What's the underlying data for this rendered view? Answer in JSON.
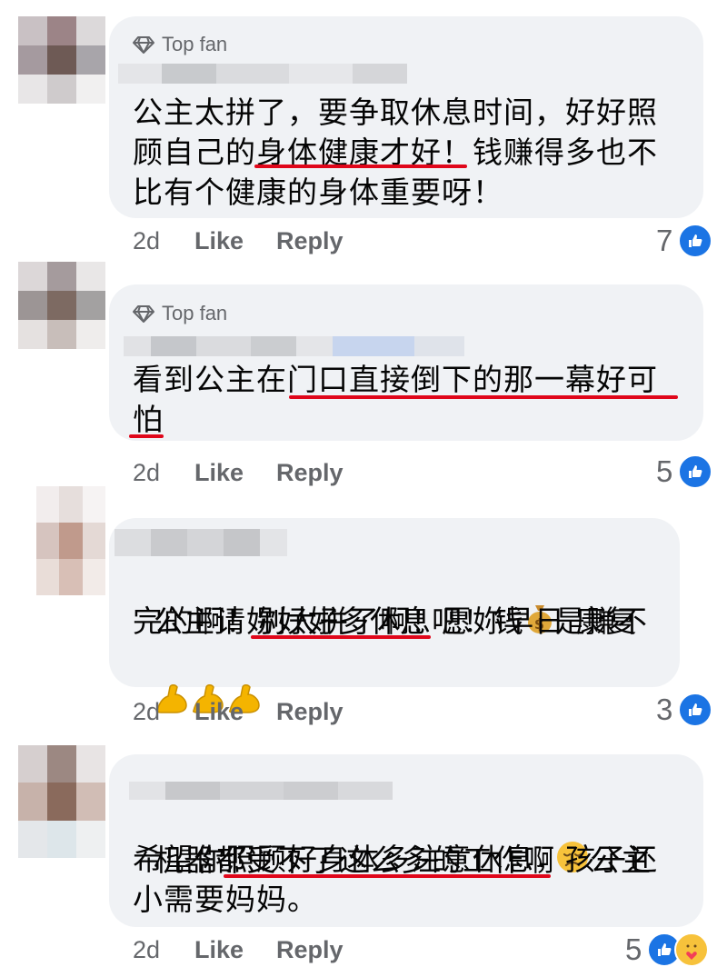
{
  "labels": {
    "top_fan": "Top fan",
    "like": "Like",
    "reply": "Reply"
  },
  "colors": {
    "bubble": "#f0f2f5",
    "underline": "#e0061a",
    "like_blue": "#1b74e4",
    "meta_gray": "#65676b"
  },
  "comments": [
    {
      "top_fan": true,
      "lines": [
        "公主太拼了，要争取休息时间，好好照",
        "顾自己的身体健康才好！钱赚得多也不",
        "比有个健康的身体重要呀！"
      ],
      "age": "2d",
      "reactions": {
        "count": "7",
        "icons": [
          "like-icon"
        ]
      }
    },
    {
      "top_fan": true,
      "lines": [
        "看到公主在门口直接倒下的那一幕好可",
        "怕"
      ],
      "age": "2d",
      "reactions": {
        "count": "5",
        "icons": [
          "like-icon"
        ]
      }
    },
    {
      "top_fan": false,
      "lines": [
        "公主请妳好好多休息吧！钱",
        "是赚不",
        "完的啊！别太拼了啊！愿妳早日 康复"
      ],
      "emojis": [
        "money-bag-icon",
        "flexed-biceps-icon",
        "flexed-biceps-icon",
        "flexed-biceps-icon"
      ],
      "age": "2d",
      "reactions": {
        "count": "3",
        "icons": [
          "like-icon"
        ]
      }
    },
    {
      "top_fan": false,
      "lines": [
        "机器都受不了这么多的工作啊",
        "公主",
        "希望你照顾好身体多注意休息，孩子还",
        "小需要妈妈。"
      ],
      "emojis": [
        "disappointed-face-icon"
      ],
      "age": "2d",
      "reactions": {
        "count": "5",
        "icons": [
          "like-icon",
          "care-icon"
        ]
      }
    }
  ]
}
